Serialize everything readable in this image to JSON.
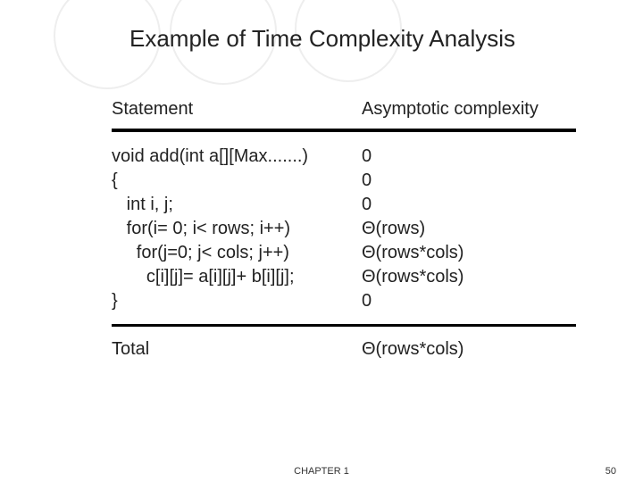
{
  "title": "Example of Time Complexity Analysis",
  "headers": {
    "left": "Statement",
    "right": "Asymptotic complexity"
  },
  "rows": [
    {
      "stmt": "void add(int a[][Max.......)",
      "comp": "0"
    },
    {
      "stmt": "{",
      "comp": "0"
    },
    {
      "stmt": "   int i, j;",
      "comp": "0"
    },
    {
      "stmt": "   for(i= 0; i< rows; i++)",
      "comp": "Θ(rows)"
    },
    {
      "stmt": "     for(j=0; j< cols; j++)",
      "comp": "Θ(rows*cols)"
    },
    {
      "stmt": "       c[i][j]= a[i][j]+ b[i][j];",
      "comp": "Θ(rows*cols)"
    },
    {
      "stmt": "}",
      "comp": "0"
    }
  ],
  "total": {
    "label": "Total",
    "value": "Θ(rows*cols)"
  },
  "footer": {
    "chapter": "CHAPTER 1",
    "page": "50"
  }
}
